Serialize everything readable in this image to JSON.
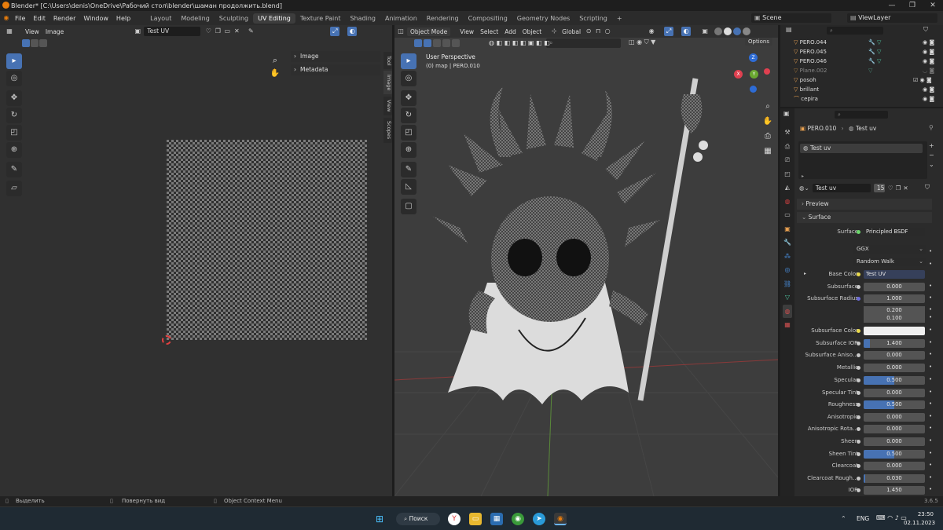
{
  "window": {
    "title": "Blender* [C:\\Users\\denis\\OneDrive\\Рабочий стол\\blender\\шаман продолжить.blend]",
    "controls": [
      "—",
      "❐",
      "✕"
    ]
  },
  "topbar": {
    "menus": [
      "File",
      "Edit",
      "Render",
      "Window",
      "Help"
    ],
    "workspaces": [
      "Layout",
      "Modeling",
      "Sculpting",
      "UV Editing",
      "Texture Paint",
      "Shading",
      "Animation",
      "Rendering",
      "Compositing",
      "Geometry Nodes",
      "Scripting"
    ],
    "active_workspace": "UV Editing",
    "add_tab": "+",
    "scene": "Scene",
    "view_layer": "ViewLayer"
  },
  "uv_editor": {
    "menus": [
      "View",
      "Image"
    ],
    "image_name": "Test UV",
    "npanel": [
      "Image",
      "Metadata"
    ],
    "tabs": [
      "Tool",
      "Image",
      "View",
      "Scopes"
    ]
  },
  "viewport": {
    "mode": "Object Mode",
    "menus": [
      "View",
      "Select",
      "Add",
      "Object"
    ],
    "orientation": "Global",
    "options": "Options",
    "overlay_title": "User Perspective",
    "overlay_sub": "(0) map | PERO.010",
    "gizmo": {
      "x": "X",
      "y": "Y",
      "z": "Z"
    }
  },
  "outliner": {
    "items": [
      {
        "name": "PERO.044",
        "dim": false
      },
      {
        "name": "PERO.045",
        "dim": false
      },
      {
        "name": "PERO.046",
        "dim": false
      },
      {
        "name": "Plane.002",
        "dim": true
      },
      {
        "name": "posoh",
        "dim": false
      },
      {
        "name": "brillant",
        "dim": false
      },
      {
        "name": "cepira",
        "dim": false
      }
    ]
  },
  "properties": {
    "object": "PERO.010",
    "material": "Test uv",
    "slot": "Test uv",
    "mat_field": "Test uv",
    "users": "15",
    "preview": "Preview",
    "surface_section": "Surface",
    "surface_label": "Surface",
    "surface_value": "Principled BSDF",
    "distribution": "GGX",
    "sss_method": "Random Walk",
    "base_color_label": "Base Color",
    "base_color_value": "Test UV",
    "rows": [
      {
        "label": "Subsurface",
        "value": "0.000",
        "fill": 0
      },
      {
        "label": "Subsurface Radius",
        "value": "1.000",
        "fill": 0
      },
      {
        "label": "",
        "value": "0.200",
        "fill": 0
      },
      {
        "label": "",
        "value": "0.100",
        "fill": 0
      },
      {
        "label": "Subsurface Color",
        "value": "",
        "fill": 0
      },
      {
        "label": "Subsurface IOR",
        "value": "1.400",
        "fill": 0.1
      },
      {
        "label": "Subsurface Aniso…",
        "value": "0.000",
        "fill": 0
      },
      {
        "label": "Metallic",
        "value": "0.000",
        "fill": 0
      },
      {
        "label": "Specular",
        "value": "0.500",
        "fill": 0.5
      },
      {
        "label": "Specular Tint",
        "value": "0.000",
        "fill": 0
      },
      {
        "label": "Roughness",
        "value": "0.500",
        "fill": 0.5
      },
      {
        "label": "Anisotropic",
        "value": "0.000",
        "fill": 0
      },
      {
        "label": "Anisotropic Rota…",
        "value": "0.000",
        "fill": 0
      },
      {
        "label": "Sheen",
        "value": "0.000",
        "fill": 0
      },
      {
        "label": "Sheen Tint",
        "value": "0.500",
        "fill": 0.5
      },
      {
        "label": "Clearcoat",
        "value": "0.000",
        "fill": 0
      },
      {
        "label": "Clearcoat Rough…",
        "value": "0.030",
        "fill": 0.03
      },
      {
        "label": "IOR",
        "value": "1.450",
        "fill": 0
      }
    ]
  },
  "statusbar": {
    "select": "Выделить",
    "rotate": "Повернуть вид",
    "context": "Object Context Menu",
    "version": "3.6.5"
  },
  "taskbar": {
    "search": "Поиск",
    "lang": "ENG",
    "time": "23:50",
    "date": "02.11.2023"
  }
}
